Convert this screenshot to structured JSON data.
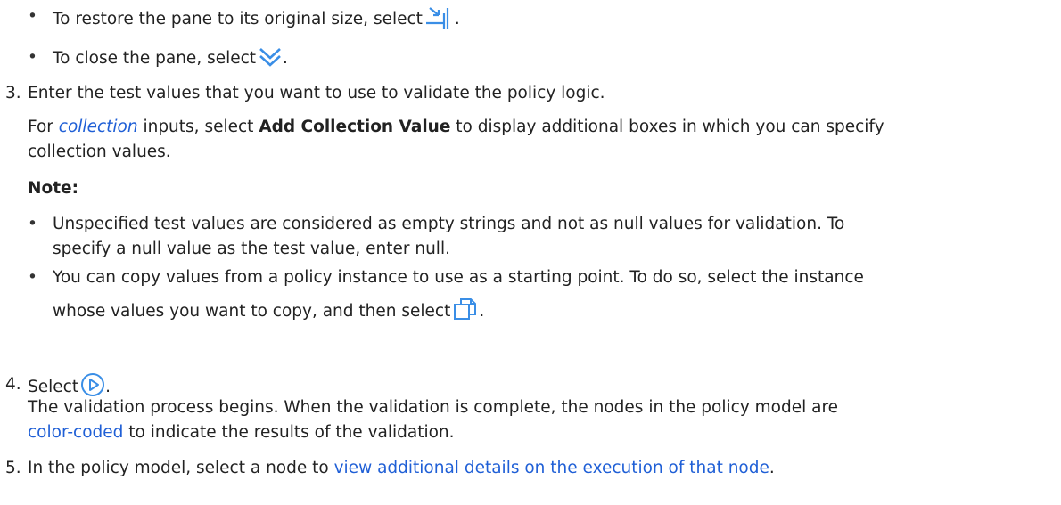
{
  "bullets_top": [
    {
      "text": "To restore the pane to its original size, select",
      "icon": "restore-pane-icon",
      "suffix": "."
    },
    {
      "text": "To close the pane, select",
      "icon": "close-pane-chevron-icon",
      "suffix": "."
    }
  ],
  "step3": {
    "number": "3.",
    "text": "Enter the test values that you want to use to validate the policy logic.",
    "para_prefix": "For",
    "para_term": "collection",
    "para_mid": "inputs, select",
    "para_bold": "Add Collection Value",
    "para_rest_line1": "to display additional boxes in which you can specify",
    "para_rest_line2": "collection values.",
    "note_label": "Note:",
    "notes": [
      {
        "line1": "Unspecified test values are considered as empty strings and not as null values for validation. To",
        "line2": "specify a null value as the test value, enter null."
      },
      {
        "line1": "You can copy values from a policy instance to use as a starting point. To do so, select the instance",
        "line2": "whose values you want to copy, and then select",
        "icon": "copy-instance-icon",
        "suffix": "."
      }
    ]
  },
  "step4": {
    "number": "4.",
    "text": "Select",
    "icon": "play-validate-icon",
    "suffix": ".",
    "result_line1": "The validation process begins. When the validation is complete, the nodes in the policy model are",
    "result_link": "color-coded",
    "result_line2_rest": "to indicate the results of the validation."
  },
  "step5": {
    "number": "5.",
    "text": "In the policy model, select a node to",
    "link": "view additional details on the execution of that node",
    "suffix": "."
  },
  "colors": {
    "link": "#1f5fd6",
    "icon_blue": "#3a8ee6"
  }
}
